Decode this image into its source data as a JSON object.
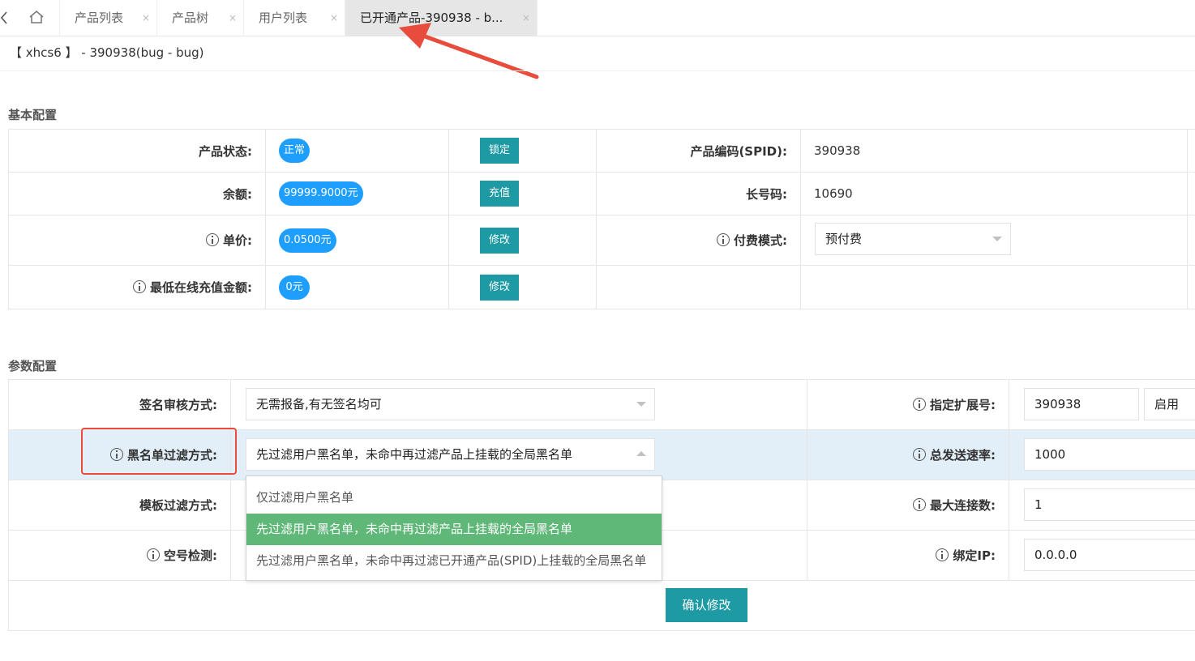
{
  "tabs": {
    "items": [
      {
        "label": "产品列表",
        "close": "×"
      },
      {
        "label": "产品树",
        "close": "×"
      },
      {
        "label": "用户列表",
        "close": "×"
      },
      {
        "label": "已开通产品-390938 - b...",
        "close": "×"
      }
    ]
  },
  "breadcrumb": "【 xhcs6 】 - 390938(bug - bug)",
  "basic": {
    "title": "基本配置",
    "status_label": "产品状态:",
    "status_value": "正常",
    "status_btn": "锁定",
    "spid_label": "产品编码(SPID):",
    "spid_value": "390938",
    "balance_label": "余额:",
    "balance_value": "99999.9000元",
    "balance_btn": "充值",
    "longcode_label": "长号码:",
    "longcode_value": "10690",
    "price_label": "单价:",
    "price_value": "0.0500元",
    "price_btn": "修改",
    "paymode_label": "付费模式:",
    "paymode_value": "预付费",
    "minrecharge_label": "最低在线充值金额:",
    "minrecharge_value": "0元",
    "minrecharge_btn": "修改"
  },
  "params": {
    "title": "参数配置",
    "sign_label": "签名审核方式:",
    "sign_value": "无需报备,有无签名均可",
    "ext_label": "指定扩展号:",
    "ext_value": "390938",
    "ext_state": "启用",
    "blacklist_label": "黑名单过滤方式:",
    "blacklist_value": "先过滤用户黑名单，未命中再过滤产品上挂载的全局黑名单",
    "rate_label": "总发送速率:",
    "rate_value": "1000",
    "template_label": "模板过滤方式:",
    "maxconn_label": "最大连接数:",
    "maxconn_value": "1",
    "empty_label": "空号检测:",
    "ip_label": "绑定IP:",
    "ip_value": "0.0.0.0",
    "dropdown_options": [
      "仅过滤用户黑名单",
      "先过滤用户黑名单，未命中再过滤产品上挂载的全局黑名单",
      "先过滤用户黑名单，未命中再过滤已开通产品(SPID)上挂载的全局黑名单"
    ],
    "confirm_btn": "确认修改"
  },
  "colors": {
    "pill": "#1e9fff",
    "teal_button": "#1e9aa5",
    "selected_option": "#5fb878",
    "annotation": "#e84c3d",
    "row_highlight": "#e3eff8"
  }
}
